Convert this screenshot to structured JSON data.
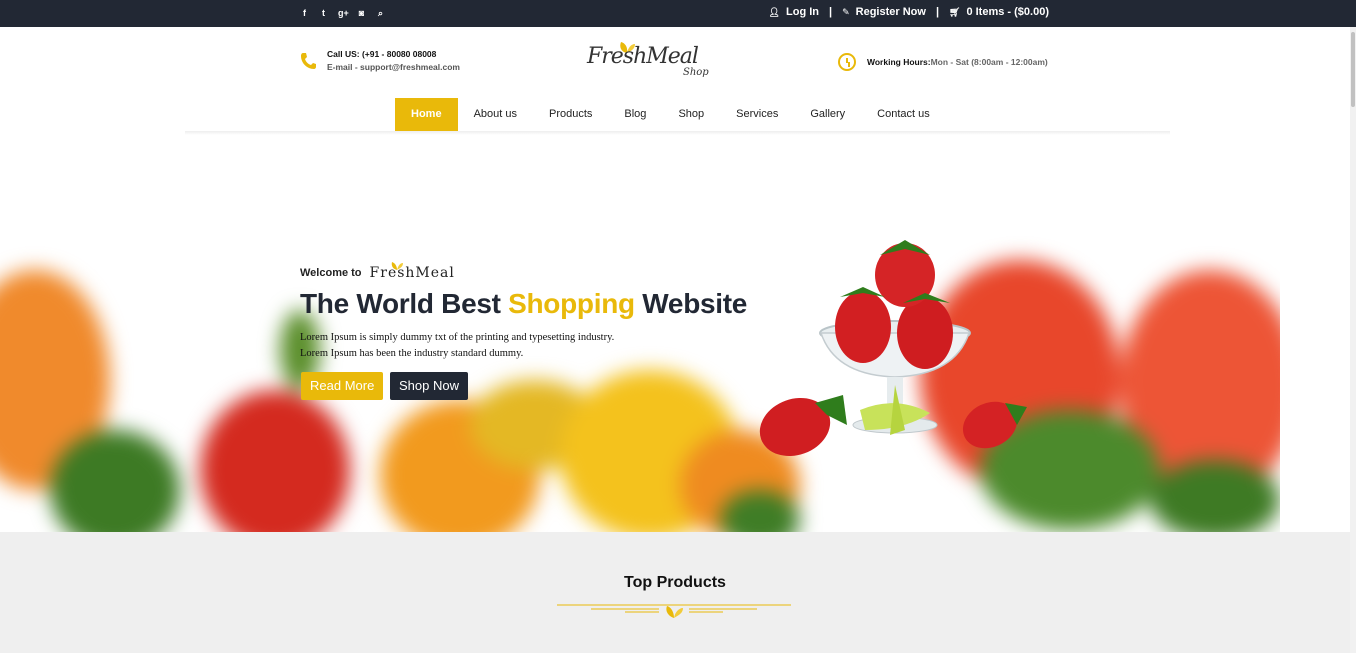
{
  "topbar": {
    "social": [
      {
        "icon": "facebook-icon",
        "glyph": "f"
      },
      {
        "icon": "twitter-icon",
        "glyph": "t"
      },
      {
        "icon": "google-plus-icon",
        "glyph": "g+"
      },
      {
        "icon": "instagram-icon",
        "glyph": "◙"
      },
      {
        "icon": "search-icon",
        "glyph": "⌕"
      }
    ],
    "login": "Log In",
    "register": "Register Now",
    "cart": "0 Items - ($0.00)",
    "separator": "|"
  },
  "header": {
    "call": "Call US: (+91 - 80080 08008",
    "email": "E-mail - support@freshmeal.com",
    "logo_text": "FreshMeal",
    "logo_sub": "Shop",
    "hours_label": "Working Hours:",
    "hours_value": "Mon - Sat (8:00am - 12:00am)"
  },
  "nav": {
    "items": [
      "Home",
      "About us",
      "Products",
      "Blog",
      "Shop",
      "Services",
      "Gallery",
      "Contact us"
    ],
    "active": "Home"
  },
  "hero": {
    "welcome": "Welcome to",
    "brand": "FreshMeal",
    "headline_pre": "The World Best",
    "headline_highlight": "Shopping",
    "headline_post": "Website",
    "desc_line1": "Lorem Ipsum is simply dummy txt of the printing and typesetting industry.",
    "desc_line2": "Lorem Ipsum has been the industry standard dummy.",
    "read_more": "Read More",
    "shop_now": "Shop Now"
  },
  "products": {
    "title": "Top Products"
  },
  "colors": {
    "accent": "#e9b90a",
    "dark": "#222834"
  }
}
